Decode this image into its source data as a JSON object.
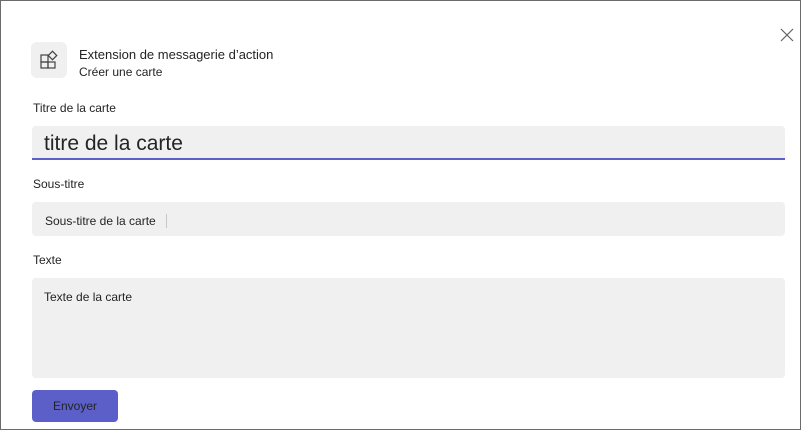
{
  "header": {
    "title": "Extension de messagerie d’action",
    "subtitle": "Créer une carte",
    "app_icon": "apps-add-icon",
    "close_icon": "close-icon"
  },
  "form": {
    "title_field": {
      "label": "Titre de la carte",
      "value": "titre de la carte"
    },
    "subtitle_field": {
      "label": "Sous-titre",
      "placeholder": "Sous-titre de la carte"
    },
    "text_field": {
      "label": "Texte",
      "placeholder": "Texte de la carte"
    }
  },
  "actions": {
    "submit_label": "Envoyer"
  },
  "colors": {
    "accent": "#5b5fc7",
    "field_background": "#f0f0f0"
  }
}
